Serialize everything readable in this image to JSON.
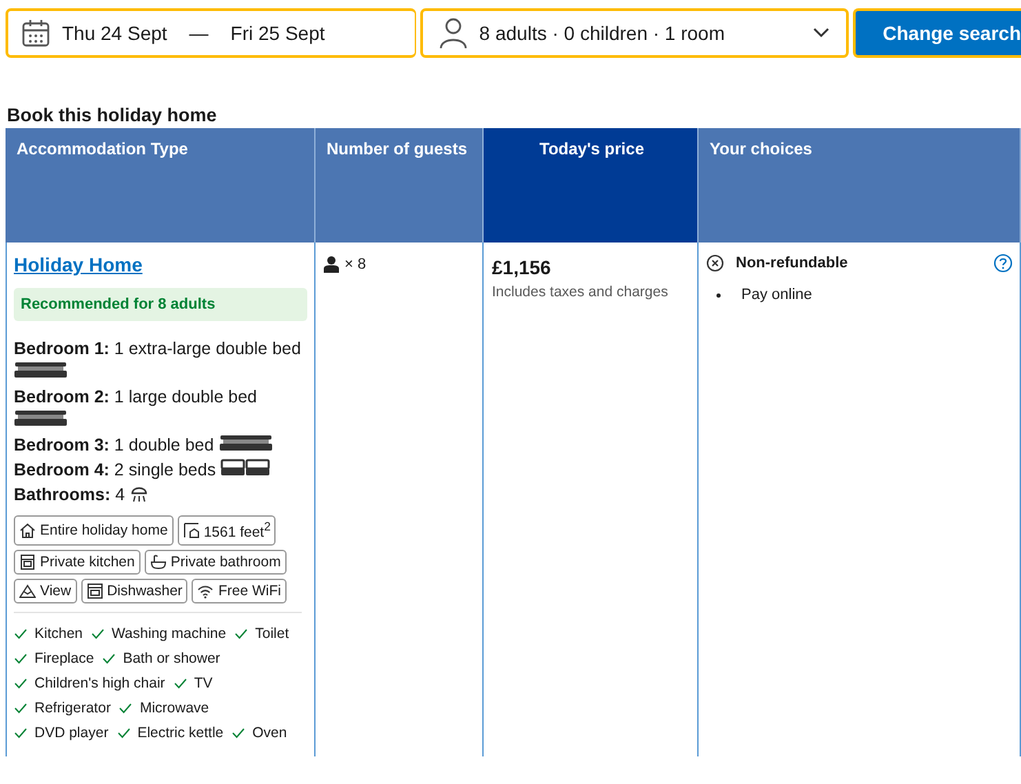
{
  "search_bar": {
    "check_in": "Thu 24 Sept",
    "separator": "—",
    "check_out": "Fri 25 Sept",
    "guests": "8 adults · 0 children · 1 room",
    "button": "Change search"
  },
  "heading": "Book this holiday home",
  "table": {
    "columns": [
      {
        "label": "Accommodation Type",
        "highlighted": false
      },
      {
        "label": "Number of guests",
        "highlighted": false
      },
      {
        "label": "Today's price",
        "highlighted": true
      },
      {
        "label": "Your choices",
        "highlighted": false
      }
    ],
    "row": {
      "name": "Holiday Home",
      "recommendation": "Recommended for 8 adults",
      "rooms": [
        {
          "text": "**Bedroom 1:** 1 extra-large double bed",
          "beds": [
            {
              "kind": "wide"
            }
          ]
        },
        {
          "text": "**Bedroom 2:** 1 large double bed",
          "beds": [
            {
              "kind": "wide"
            }
          ]
        },
        {
          "text": "**Bedroom 3:** 1 double bed",
          "beds": [
            {
              "kind": "wide"
            }
          ]
        },
        {
          "text": "**Bedroom 4:** 2 single beds",
          "beds": [
            {
              "kind": "single"
            },
            {
              "kind": "single"
            }
          ]
        },
        {
          "text": "**Bathrooms:** 4",
          "beds": [
            {
              "kind": "shower"
            }
          ]
        }
      ],
      "tags": [
        {
          "kind": "house",
          "label": "Entire holiday home"
        },
        {
          "kind": "size",
          "label": "1561 feet$^{2}$"
        },
        {
          "kind": "kitchen",
          "label": "Private kitchen"
        },
        {
          "kind": "bath",
          "label": "Private bathroom"
        },
        {
          "kind": "mountain",
          "label": "View"
        },
        {
          "kind": "dishwasher",
          "label": "Dishwasher"
        },
        {
          "kind": "wifi",
          "label": "Free WiFi"
        }
      ],
      "facilities": [
        [
          "Kitchen",
          "Washing machine",
          "Toilet"
        ],
        [
          "Fireplace",
          "Bath or shower"
        ],
        [
          "Children's high chair",
          "TV"
        ],
        [
          "Refrigerator",
          "Microwave"
        ],
        [
          "DVD player",
          "Electric kettle",
          "Oven"
        ]
      ],
      "guests": "× 8",
      "price": "£1,156",
      "price_note": "Includes taxes and charges",
      "policy": "Non-refundable",
      "payment": "Pay online"
    }
  }
}
